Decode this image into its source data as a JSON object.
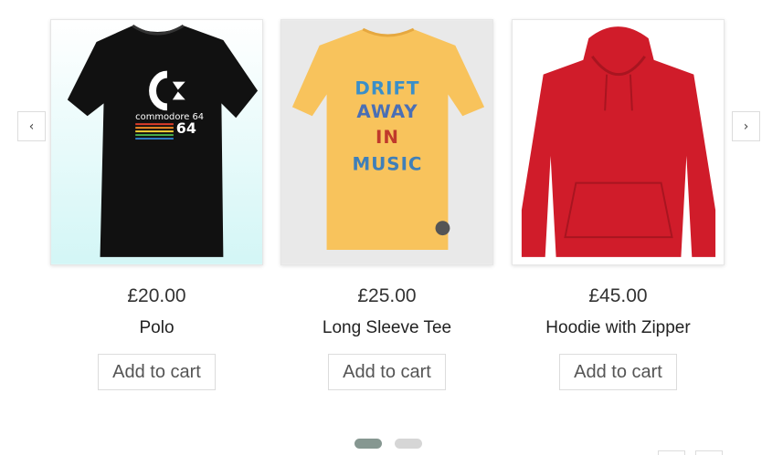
{
  "carousel": {
    "prev_label": "‹",
    "next_label": "›",
    "products": [
      {
        "price": "£20.00",
        "name": "Polo",
        "button": "Add to cart",
        "image_text": "commodore 64"
      },
      {
        "price": "£25.00",
        "name": "Long Sleeve Tee",
        "button": "Add to cart",
        "image_text": "DRIFT AWAY IN MUSIC"
      },
      {
        "price": "£45.00",
        "name": "Hoodie with Zipper",
        "button": "Add to cart",
        "image_text": ""
      }
    ],
    "pagination": {
      "pages": 2,
      "active": 1
    }
  },
  "colors": {
    "tee_black": "#111111",
    "tee_yellow": "#f8c35c",
    "hoodie_red": "#d01c2a",
    "active_dot": "#869791"
  }
}
